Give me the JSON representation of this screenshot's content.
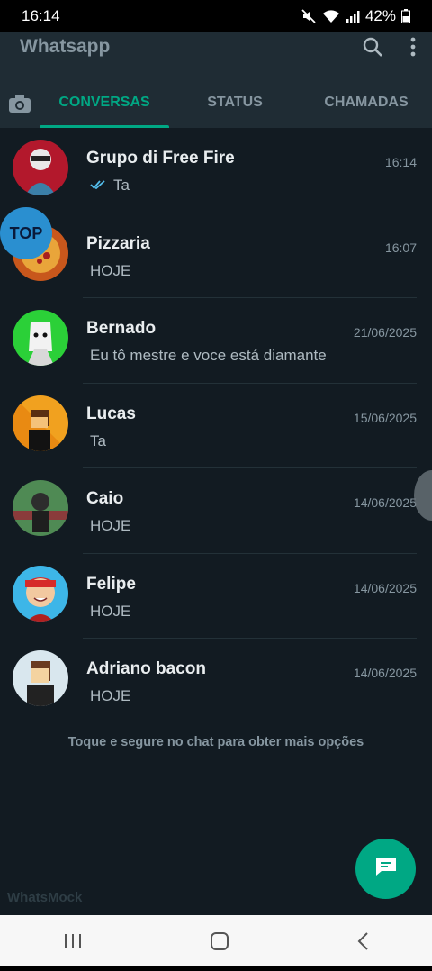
{
  "status_bar": {
    "time": "16:14",
    "battery": "42%"
  },
  "header": {
    "title": "Whatsapp"
  },
  "tabs": [
    {
      "label": "CONVERSAS",
      "active": true
    },
    {
      "label": "STATUS",
      "active": false
    },
    {
      "label": "CHAMADAS",
      "active": false
    }
  ],
  "chats": [
    {
      "name": "Grupo di Free Fire",
      "time": "16:14",
      "message": "Ta",
      "read_ticks": true,
      "avatar_color": "#b3182c"
    },
    {
      "name": "Pizzaria",
      "time": "16:07",
      "message": "HOJE",
      "read_ticks": false,
      "avatar_color": "#c8571c"
    },
    {
      "name": "Bernado",
      "time": "21/06/2025",
      "message": "Eu tô mestre e voce está diamante",
      "read_ticks": false,
      "avatar_color": "#2bd038"
    },
    {
      "name": "Lucas",
      "time": "15/06/2025",
      "message": "Ta",
      "read_ticks": false,
      "avatar_color": "#f1a11f"
    },
    {
      "name": "Caio",
      "time": "14/06/2025",
      "message": "HOJE",
      "read_ticks": false,
      "avatar_color": "#4f8a54"
    },
    {
      "name": "Felipe",
      "time": "14/06/2025",
      "message": "HOJE",
      "read_ticks": false,
      "avatar_color": "#3db6e8"
    },
    {
      "name": "Adriano bacon",
      "time": "14/06/2025",
      "message": "HOJE",
      "read_ticks": false,
      "avatar_color": "#d9e7ee"
    }
  ],
  "hint": "Toque e segure no chat para obter mais opções",
  "overlay_badge": "TOP",
  "watermark": "WhatsMock",
  "colors": {
    "accent": "#00a884",
    "background": "#121b22",
    "header": "#1f2c34"
  }
}
